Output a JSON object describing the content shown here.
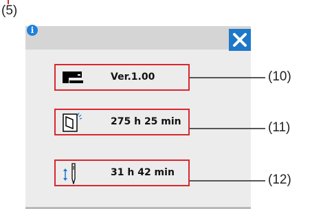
{
  "callouts": {
    "top": "(5)",
    "r10": "(10)",
    "r11": "(11)",
    "r12": "(12)"
  },
  "dialog": {
    "version_text": "Ver.1.00",
    "power_on_time": "275 h 25 min",
    "needle_time": "31 h 42 min"
  },
  "icons": {
    "info": "info-icon",
    "close": "close-icon",
    "machine": "sewing-machine-icon",
    "power": "power-switch-icon",
    "needle": "needle-icon"
  },
  "colors": {
    "highlight": "#d9262c",
    "close_button": "#1e78c8",
    "info": "#1f7fd9"
  }
}
